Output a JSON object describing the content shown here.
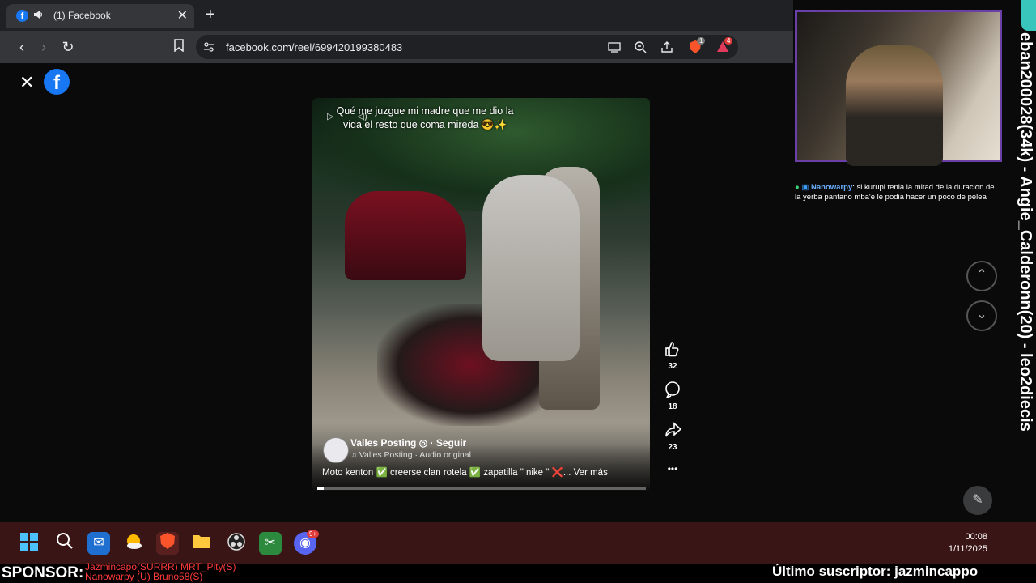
{
  "browser": {
    "tab_title": "(1) Facebook",
    "tab_close": "✕",
    "new_tab": "+",
    "url": "facebook.com/reel/699420199380483",
    "shield_badge": "1",
    "alert_badge": "4"
  },
  "page": {
    "close": "✕",
    "logo": "f"
  },
  "reel": {
    "caption": "Qué me juzgue mi madre que me dio la vida  el resto que coma mireda 😎✨",
    "page_name": "Valles Posting",
    "follow": "Seguir",
    "audio": "Valles Posting · Audio original",
    "description": "Moto kenton ✅ creerse clan rotela ✅ zapatilla \" nike \" ❌... Ver más",
    "progress": 0.02,
    "likes": "32",
    "comments": "18",
    "shares": "23",
    "more": "•••"
  },
  "stream": {
    "chat_user": "Nanowarpy",
    "chat_message": "si kurupi tenia la mitad de la duracion de la yerba pantano mba'e le podia hacer un poco de pelea",
    "vertical_text": "eban200028(34k) - Angie_Calderonn(20) - leo2diecis",
    "sponsor_label": "SPONSOR:",
    "sponsor_line1": "Jazmincapo(SURRR) MRT_Pity(S)",
    "sponsor_line2": "Nanowarpy (U) Bruno58(S)",
    "last_sub": "Último suscriptor: jazmincappo"
  },
  "taskbar": {
    "time": "00:08",
    "date": "1/11/2025",
    "discord_badge": "9+"
  },
  "colors": {
    "facebook_blue": "#1877f2",
    "taskbar": "#3a1515",
    "cam_border": "#6a3fa8",
    "sponsor_red": "#ff3b3b"
  },
  "icons": [
    "facebook-icon",
    "speaker-icon",
    "back-icon",
    "forward-icon",
    "reload-icon",
    "bookmark-icon",
    "site-settings-icon",
    "cast-icon",
    "zoom-icon",
    "share-icon",
    "brave-shield-icon",
    "brave-rewards-icon",
    "like-icon",
    "comment-icon",
    "share-reel-icon",
    "more-icon",
    "chevron-up-icon",
    "chevron-down-icon",
    "edit-icon"
  ]
}
